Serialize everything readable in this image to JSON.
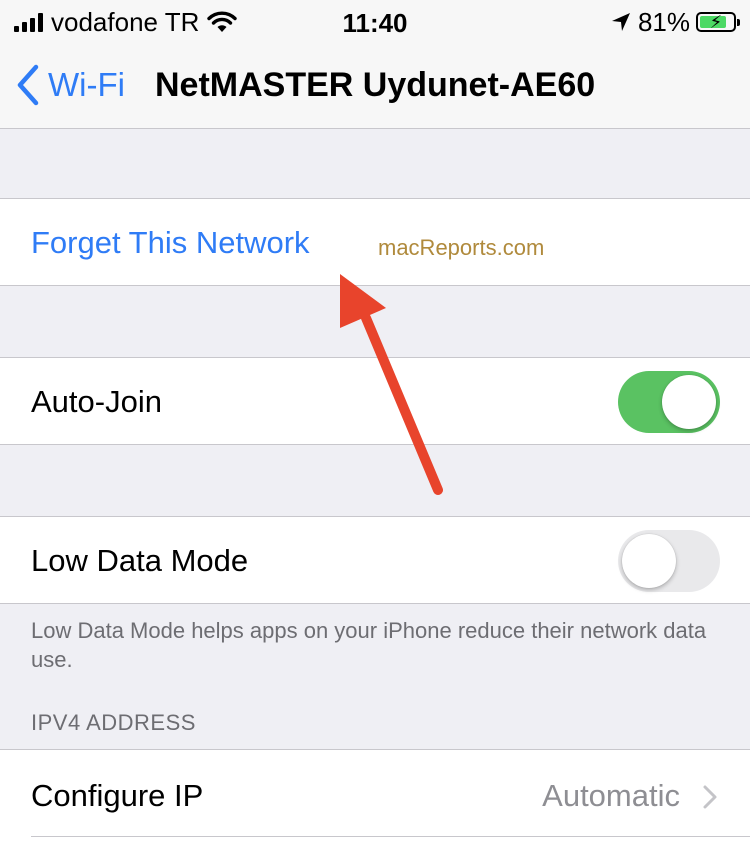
{
  "status_bar": {
    "carrier": "vodafone TR",
    "time": "11:40",
    "battery_percent": "81%",
    "battery_level": 0.81,
    "icons": [
      "cellular-signal-icon",
      "wifi-icon",
      "location-arrow-icon",
      "battery-charging-icon"
    ]
  },
  "nav": {
    "back_label": "Wi-Fi",
    "title": "NetMASTER Uydunet-AE60"
  },
  "forget": {
    "label": "Forget This Network",
    "watermark": "macReports.com"
  },
  "auto_join": {
    "label": "Auto-Join",
    "enabled": true
  },
  "low_data_mode": {
    "label": "Low Data Mode",
    "enabled": false,
    "footer": "Low Data Mode helps apps on your iPhone reduce their network data use."
  },
  "ipv4": {
    "header": "IPV4 ADDRESS",
    "configure_label": "Configure IP",
    "configure_value": "Automatic"
  },
  "colors": {
    "accent": "#2f7cf6",
    "toggle_on": "#5ac262",
    "toggle_off": "#e9e9eb",
    "arrow": "#e8442c",
    "watermark": "#b08a3c"
  }
}
